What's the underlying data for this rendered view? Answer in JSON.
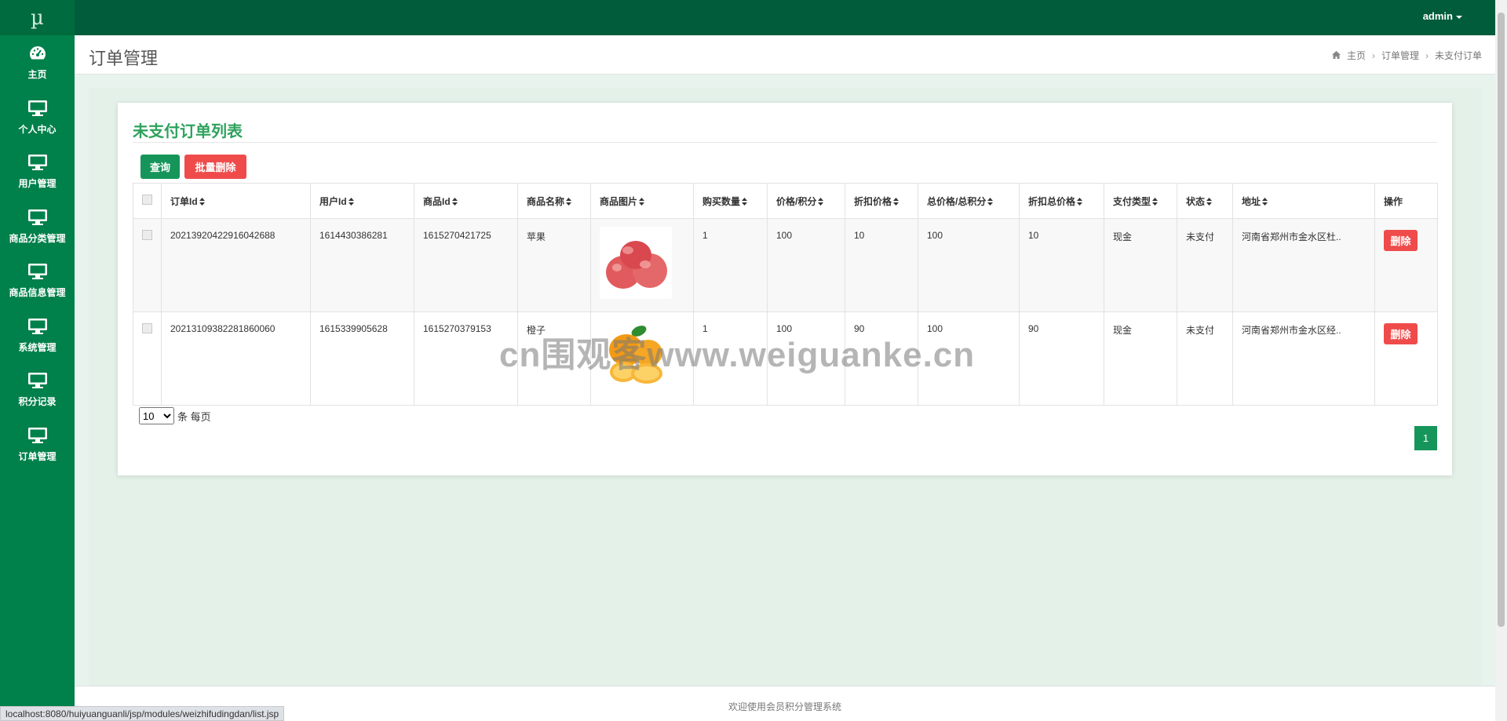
{
  "sidebar": {
    "logo": "µ",
    "items": [
      {
        "label": "主页",
        "icon": "dashboard-icon"
      },
      {
        "label": "个人中心",
        "icon": "monitor-icon"
      },
      {
        "label": "用户管理",
        "icon": "monitor-icon"
      },
      {
        "label": "商品分类管理",
        "icon": "monitor-icon"
      },
      {
        "label": "商品信息管理",
        "icon": "monitor-icon"
      },
      {
        "label": "系统管理",
        "icon": "monitor-icon"
      },
      {
        "label": "积分记录",
        "icon": "monitor-icon"
      },
      {
        "label": "订单管理",
        "icon": "monitor-icon"
      }
    ]
  },
  "topbar": {
    "user": "admin"
  },
  "page": {
    "title": "订单管理"
  },
  "breadcrumb": {
    "home": "主页",
    "section": "订单管理",
    "current": "未支付订单"
  },
  "card": {
    "title": "未支付订单列表"
  },
  "toolbar": {
    "search_label": "查询",
    "batch_delete_label": "批量删除"
  },
  "table": {
    "headers": [
      "订单Id",
      "用户Id",
      "商品Id",
      "商品名称",
      "商品图片",
      "购买数量",
      "价格/积分",
      "折扣价格",
      "总价格/总积分",
      "折扣总价格",
      "支付类型",
      "状态",
      "地址",
      "操作"
    ],
    "rows": [
      {
        "order_id": "20213920422916042688",
        "user_id": "1614430386281",
        "product_id": "1615270421725",
        "product_name": "苹果",
        "image": "apple",
        "quantity": "1",
        "price": "100",
        "discount_price": "10",
        "total_price": "100",
        "discount_total": "10",
        "pay_type": "现金",
        "status": "未支付",
        "address": "河南省郑州市金水区杜..",
        "action": "删除"
      },
      {
        "order_id": "20213109382281860060",
        "user_id": "1615339905628",
        "product_id": "1615270379153",
        "product_name": "橙子",
        "image": "orange",
        "quantity": "1",
        "price": "100",
        "discount_price": "90",
        "total_price": "100",
        "discount_total": "90",
        "pay_type": "现金",
        "status": "未支付",
        "address": "河南省郑州市金水区经..",
        "action": "删除"
      }
    ]
  },
  "pagination": {
    "page_size": "10",
    "page_size_suffix": "条 每页",
    "current_page": "1"
  },
  "watermark": "cn围观客www.weiguanke.cn",
  "footer": {
    "text": "欢迎使用会员积分管理系统"
  },
  "statusbar": {
    "url": "localhost:8080/huiyuanguanli/jsp/modules/weizhifudingdan/list.jsp"
  },
  "colors": {
    "sidebar": "#00804a",
    "topbar": "#005c3b",
    "accent": "#16955a",
    "danger": "#ef4b4b",
    "title": "#2ea25d"
  }
}
